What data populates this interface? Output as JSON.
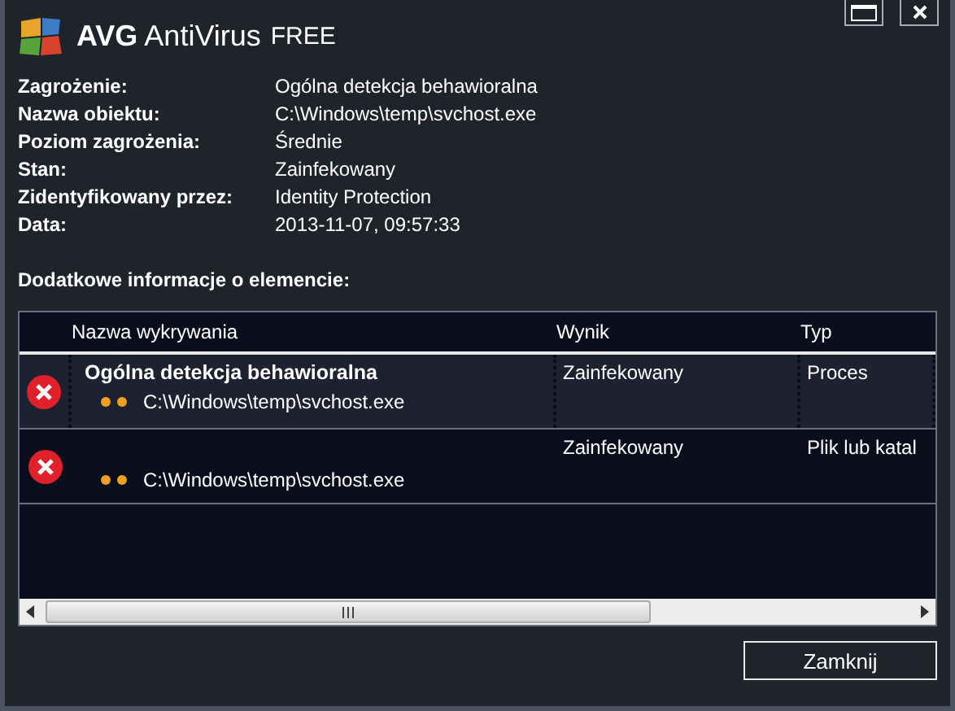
{
  "window": {
    "brand": "AVG",
    "title": "AntiVirus",
    "edition": "FREE"
  },
  "details": [
    {
      "label": "Zagrożenie:",
      "value": "Ogólna detekcja behawioralna"
    },
    {
      "label": "Nazwa obiektu:",
      "value": "C:\\Windows\\temp\\svchost.exe"
    },
    {
      "label": "Poziom zagrożenia:",
      "value": "Średnie"
    },
    {
      "label": "Stan:",
      "value": "Zainfekowany"
    },
    {
      "label": "Zidentyfikowany przez:",
      "value": "Identity Protection"
    },
    {
      "label": "Data:",
      "value": "2013-11-07, 09:57:33"
    }
  ],
  "section_title": "Dodatkowe informacje o elemencie:",
  "table": {
    "columns": [
      "Nazwa wykrywania",
      "Wynik",
      "Typ"
    ],
    "rows": [
      {
        "name": "Ogólna detekcja behawioralna",
        "path": "C:\\Windows\\temp\\svchost.exe",
        "result": "Zainfekowany",
        "type": "Proces",
        "selected": true
      },
      {
        "path": "C:\\Windows\\temp\\svchost.exe",
        "result": "Zainfekowany",
        "type": "Plik lub katal",
        "selected": false
      }
    ]
  },
  "buttons": [
    "Zamknij"
  ]
}
